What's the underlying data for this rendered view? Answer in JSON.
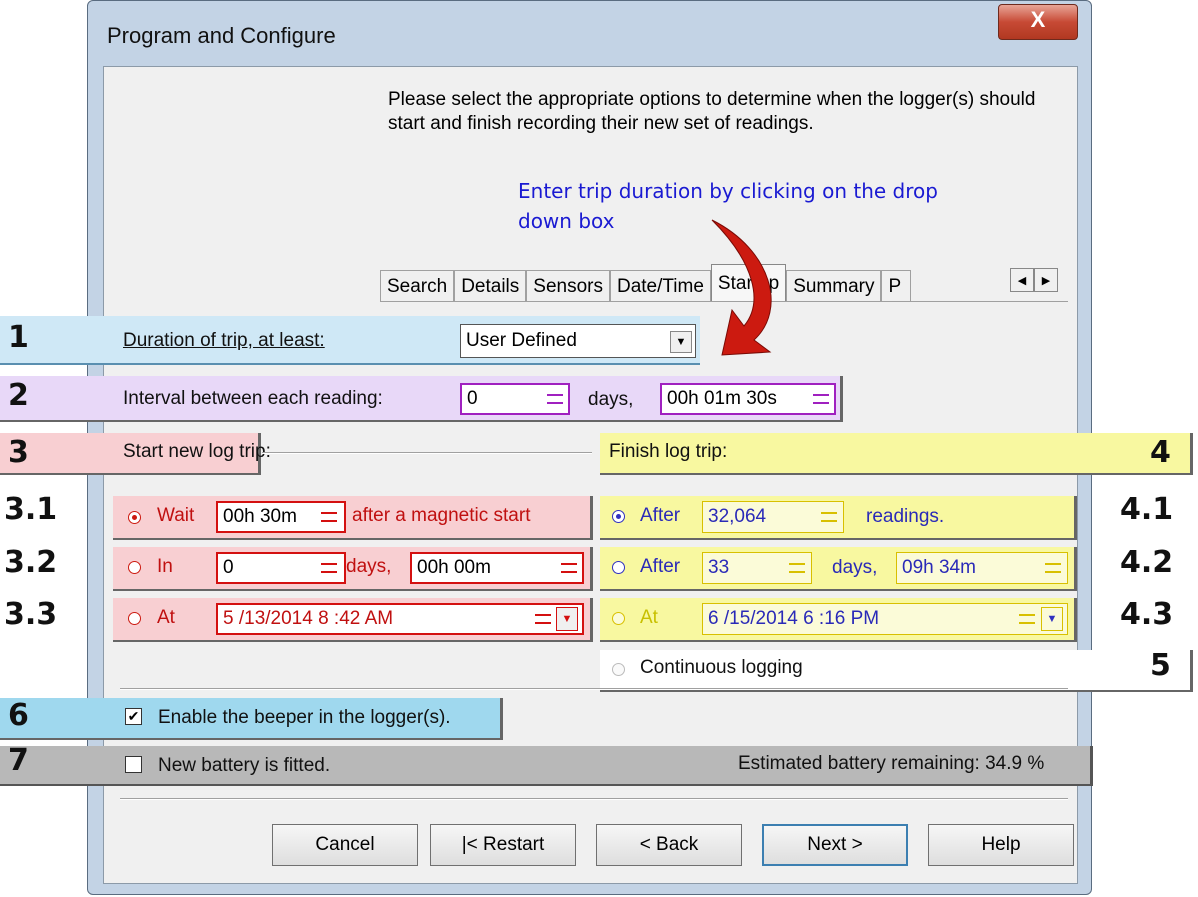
{
  "window": {
    "title": "Program and Configure",
    "close_label": "X",
    "instructions": "Please select the appropriate options to determine when the logger(s) should start and finish recording their new set of readings.",
    "annotation": "Enter trip duration by clicking on the drop down box"
  },
  "tabs": [
    {
      "label": "Search"
    },
    {
      "label": "Details"
    },
    {
      "label": "Sensors"
    },
    {
      "label": "Date/Time"
    },
    {
      "label": "Startup"
    },
    {
      "label": "Summary"
    },
    {
      "label": "P"
    }
  ],
  "markers": {
    "m1": "1",
    "m2": "2",
    "m3": "3",
    "m4": "4",
    "m31": "3.1",
    "m32": "3.2",
    "m33": "3.3",
    "m41": "4.1",
    "m42": "4.2",
    "m43": "4.3",
    "m5": "5",
    "m6": "6",
    "m7": "7"
  },
  "duration": {
    "label": "Duration of trip, at least:",
    "value": "User Defined"
  },
  "interval": {
    "label": "Interval between each reading:",
    "days_value": "0",
    "days_label": "days,",
    "time_value": "00h 01m 30s"
  },
  "start": {
    "heading": "Start new log trip:",
    "wait": {
      "label": "Wait",
      "value": "00h 30m",
      "suffix": "after a magnetic start"
    },
    "in": {
      "label": "In",
      "days_value": "0",
      "days_label": "days,",
      "time_value": "00h 00m"
    },
    "at": {
      "label": "At",
      "value": "5 /13/2014   8 :42 AM"
    }
  },
  "finish": {
    "heading": "Finish log trip:",
    "after_readings": {
      "label": "After",
      "value": "32,064",
      "suffix": "readings."
    },
    "after_days": {
      "label": "After",
      "days_value": "33",
      "days_label": "days,",
      "time_value": "09h 34m"
    },
    "at": {
      "label": "At",
      "value": "6 /15/2014   6 :16 PM"
    },
    "continuous": "Continuous logging"
  },
  "beeper": {
    "label": "Enable the beeper in the logger(s).",
    "checked": true
  },
  "battery": {
    "label": "New battery is fitted.",
    "checked": false,
    "estimate": "Estimated battery remaining:  34.9 %"
  },
  "buttons": {
    "cancel": "Cancel",
    "restart": "|< Restart",
    "back": "< Back",
    "next": "Next >",
    "help": "Help"
  },
  "colors": {
    "band_blue": "#cfe8f6",
    "band_purple": "#e8d8f8",
    "band_red": "#f8cfd2",
    "band_yellow": "#f8f8a0",
    "band_cyan": "#9fd8ee",
    "band_gray": "#b8b8b8",
    "annotation": "#1a1ad2",
    "arrow": "#cc1a10"
  }
}
